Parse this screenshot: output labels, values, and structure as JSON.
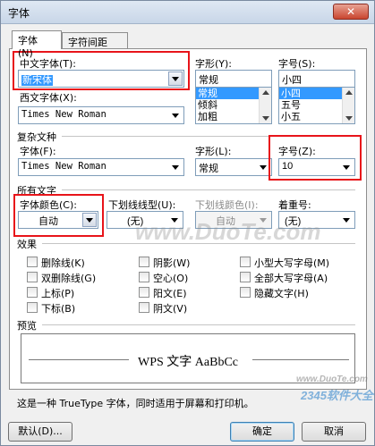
{
  "window": {
    "title": "字体",
    "close_glyph": "✕"
  },
  "tabs": [
    {
      "label": "字体 (N)",
      "active": true
    },
    {
      "label": "字符间距(R)",
      "active": false
    }
  ],
  "chinese_font": {
    "label": "中文字体(T):",
    "value": "新宋体"
  },
  "font_style": {
    "label": "字形(Y):",
    "value": "常规",
    "options": [
      "常规",
      "倾斜",
      "加粗"
    ],
    "selected_index": 0
  },
  "font_size": {
    "label": "字号(S):",
    "value": "小四",
    "options": [
      "小四",
      "五号",
      "小五"
    ],
    "selected_index": 0
  },
  "western_font": {
    "label": "西文字体(X):",
    "value": "Times New Roman"
  },
  "complex_section": {
    "title": "复杂文种",
    "font_label": "字体(F):",
    "font_value": "Times New Roman",
    "style_label": "字形(L):",
    "style_value": "常规",
    "size_label": "字号(Z):",
    "size_value": "10"
  },
  "all_text": {
    "title": "所有文字",
    "color_label": "字体颜色(C):",
    "color_value": "自动",
    "underline_label": "下划线线型(U):",
    "underline_value": "(无)",
    "underline_color_label": "下划线颜色(I):",
    "underline_color_value": "自动",
    "emphasis_label": "着重号:",
    "emphasis_value": "(无)"
  },
  "effects": {
    "title": "效果",
    "items": [
      {
        "label": "删除线(K)",
        "checked": false
      },
      {
        "label": "双删除线(G)",
        "checked": false
      },
      {
        "label": "上标(P)",
        "checked": false
      },
      {
        "label": "下标(B)",
        "checked": false
      },
      {
        "label": "阴影(W)",
        "checked": false
      },
      {
        "label": "空心(O)",
        "checked": false
      },
      {
        "label": "阳文(E)",
        "checked": false
      },
      {
        "label": "阴文(V)",
        "checked": false
      },
      {
        "label": "小型大写字母(M)",
        "checked": false
      },
      {
        "label": "全部大写字母(A)",
        "checked": false
      },
      {
        "label": "隐藏文字(H)",
        "checked": false
      }
    ]
  },
  "preview": {
    "title": "预览",
    "sample": "WPS 文字 AaBbCc"
  },
  "description": "这是一种 TrueType 字体，同时适用于屏幕和打印机。",
  "buttons": {
    "default": "默认(D)...",
    "ok": "确定",
    "cancel": "取消"
  },
  "watermarks": {
    "center": "www.DuoTe.com",
    "corner_url": "www.DuoTe.com",
    "corner_brand": "2345软件大全"
  },
  "colors": {
    "highlight_box": "#e8141a",
    "selection": "#3399ff"
  }
}
